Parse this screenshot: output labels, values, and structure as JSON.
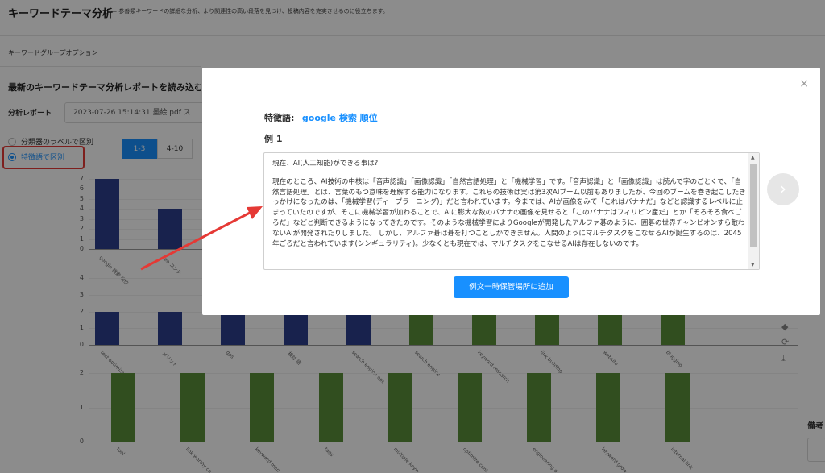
{
  "page": {
    "title": "キーワードテーマ分析",
    "description": "— 参善類キーワードの詳細な分析、より関連性の高い段落を見つけ、投稿内容を充実させるのに役立ちます。",
    "keyword_group_options": "キーワードグループオプション",
    "report_heading": "最新のキーワードテーマ分析レポートを読み込む",
    "report_label": "分析レポート",
    "report_value": "2023-07-26 15:14:31 墨絵 pdf ス",
    "radio_options": [
      "分類器のラベルで区別",
      "特徴語で区別"
    ],
    "segments": [
      "1-3",
      "4-10"
    ],
    "memo_label": "備考"
  },
  "chart_data": [
    {
      "type": "bar",
      "ylim": [
        0,
        7
      ],
      "yticks": [
        "7",
        "6",
        "5",
        "4",
        "3",
        "2",
        "1",
        "0"
      ],
      "categories": [
        "google 検索 順位",
        "seo コンテ"
      ],
      "values": [
        7,
        4
      ]
    },
    {
      "type": "bar",
      "ylim": [
        0,
        4
      ],
      "yticks": [
        "4",
        "3",
        "2",
        "1",
        "0"
      ],
      "categories": [
        "text optimization",
        "メリット",
        "gps",
        "検討 語",
        "search engine opt",
        "search engine",
        "keyword research",
        "link building",
        "website",
        "blogging"
      ],
      "values": [
        2,
        2,
        2,
        2,
        2,
        2,
        2,
        2,
        2,
        2
      ]
    },
    {
      "type": "bar",
      "ylim": [
        0,
        2
      ],
      "yticks": [
        "2",
        "1",
        "0"
      ],
      "categories": [
        "tool",
        "link worthy co",
        "keyword man",
        "tags",
        "multiple keyw",
        "optimize cont",
        "engineering o",
        "keyword grow",
        "internal link"
      ],
      "values": [
        2,
        2,
        2,
        2,
        2,
        2,
        2,
        2,
        2
      ]
    }
  ],
  "modal": {
    "feature_label": "特徴語:",
    "feature_value": "google 検索 順位",
    "example_title": "例 1",
    "question": "現在、AI(人工知能)ができる事は?",
    "body": "現在のところ、AI技術の中核は「音声認識」「画像認識」「自然言語処理」と「機械学習」です。「音声認識」と「画像認識」は読んで字のごとくで、「自然言語処理」とは、言葉のもつ意味を理解する能力になります。これらの技術は実は第3次AIブーム以前もありましたが、今回のブームを巻き起こしたきっかけになったのは、「機械学習(ディープラーニング)」だと言われています。今までは、AIが画像をみて「これはバナナだ」などと認識するレベルに止まっていたのですが、そこに機械学習が加わることで、AIに膨大な数のバナナの画像を見せると「このバナナはフィリピン産だ」とか「そろそろ食べごろだ」などと判断できるようになってきたのです。そのような機械学習によりGoogleが開発したアルファ碁のように、囲碁の世界チャンピオンすら敵わないAIが開発されたりしました。 しかし、アルファ碁は碁を打つことしかできません。人間のようにマルチタスクをこなせるAIが誕生するのは、2045年ごろだと言われています(シンギュラリティ)。少なくとも現在では、マルチタスクをこなせるAIは存在しないのです。",
    "add_button": "例文一時保管場所に追加",
    "close_icon": "×",
    "next_icon": "›"
  },
  "colors": {
    "accent": "#1890ff",
    "navy_bar": "#2c3e8c",
    "green_bar": "#5a8f3a",
    "annotation": "#e53935"
  }
}
